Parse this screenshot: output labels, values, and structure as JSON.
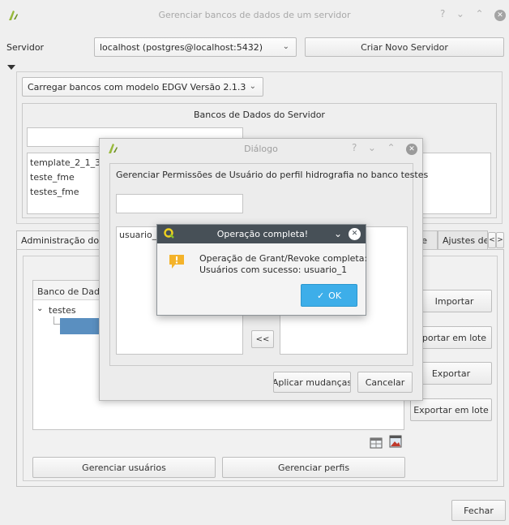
{
  "main_window": {
    "title": "Gerenciar bancos de dados de um servidor",
    "controls": {
      "help": "?",
      "min": "⌄",
      "max": "⌃",
      "close": "✕"
    },
    "server_label": "Servidor",
    "server_value": "localhost (postgres@localhost:5432)",
    "new_server_button": "Criar Novo Servidor",
    "load_combo": "Carregar bancos com modelo EDGV Versão 2.1.3",
    "group_title": "Bancos de Dados do Servidor",
    "db_list": [
      "template_2_1_3",
      "teste_fme",
      "testes_fme"
    ],
    "tabs": [
      "Administração do B",
      "re",
      "Ajustes de"
    ],
    "tab_scroll": {
      "left": "<",
      "right": ">"
    },
    "tree_header": "Banco de Dado",
    "tree_item": "testes",
    "buttons_right": [
      "Importar",
      "portar em lote",
      "Exportar",
      "Exportar em lote"
    ],
    "manage_users_button": "Gerenciar usuários",
    "manage_profiles_button": "Gerenciar perfis",
    "close_button": "Fechar"
  },
  "dialog": {
    "title": "Diálogo",
    "controls": {
      "help": "?",
      "min": "⌄",
      "max": "⌃",
      "close": "✕"
    },
    "heading": "Gerenciar Permissões de Usuário do perfil hidrografia no banco testes",
    "left_list_item": "usuario_2",
    "move_left_button": "<<",
    "apply_button": "Aplicar mudanças",
    "cancel_button": "Cancelar"
  },
  "message_box": {
    "title": "Operação completa!",
    "line1": "Operação de Grant/Revoke completa:",
    "line2": "Usuários com sucesso: usuario_1",
    "ok_button": "OK",
    "ok_check": "✓",
    "controls": {
      "min": "⌄",
      "close": "✕"
    }
  },
  "colors": {
    "accent": "#3daee9",
    "msg_title_bg": "#475057",
    "close_circle": "#8c8c8c",
    "selection": "#5a8fc0"
  }
}
